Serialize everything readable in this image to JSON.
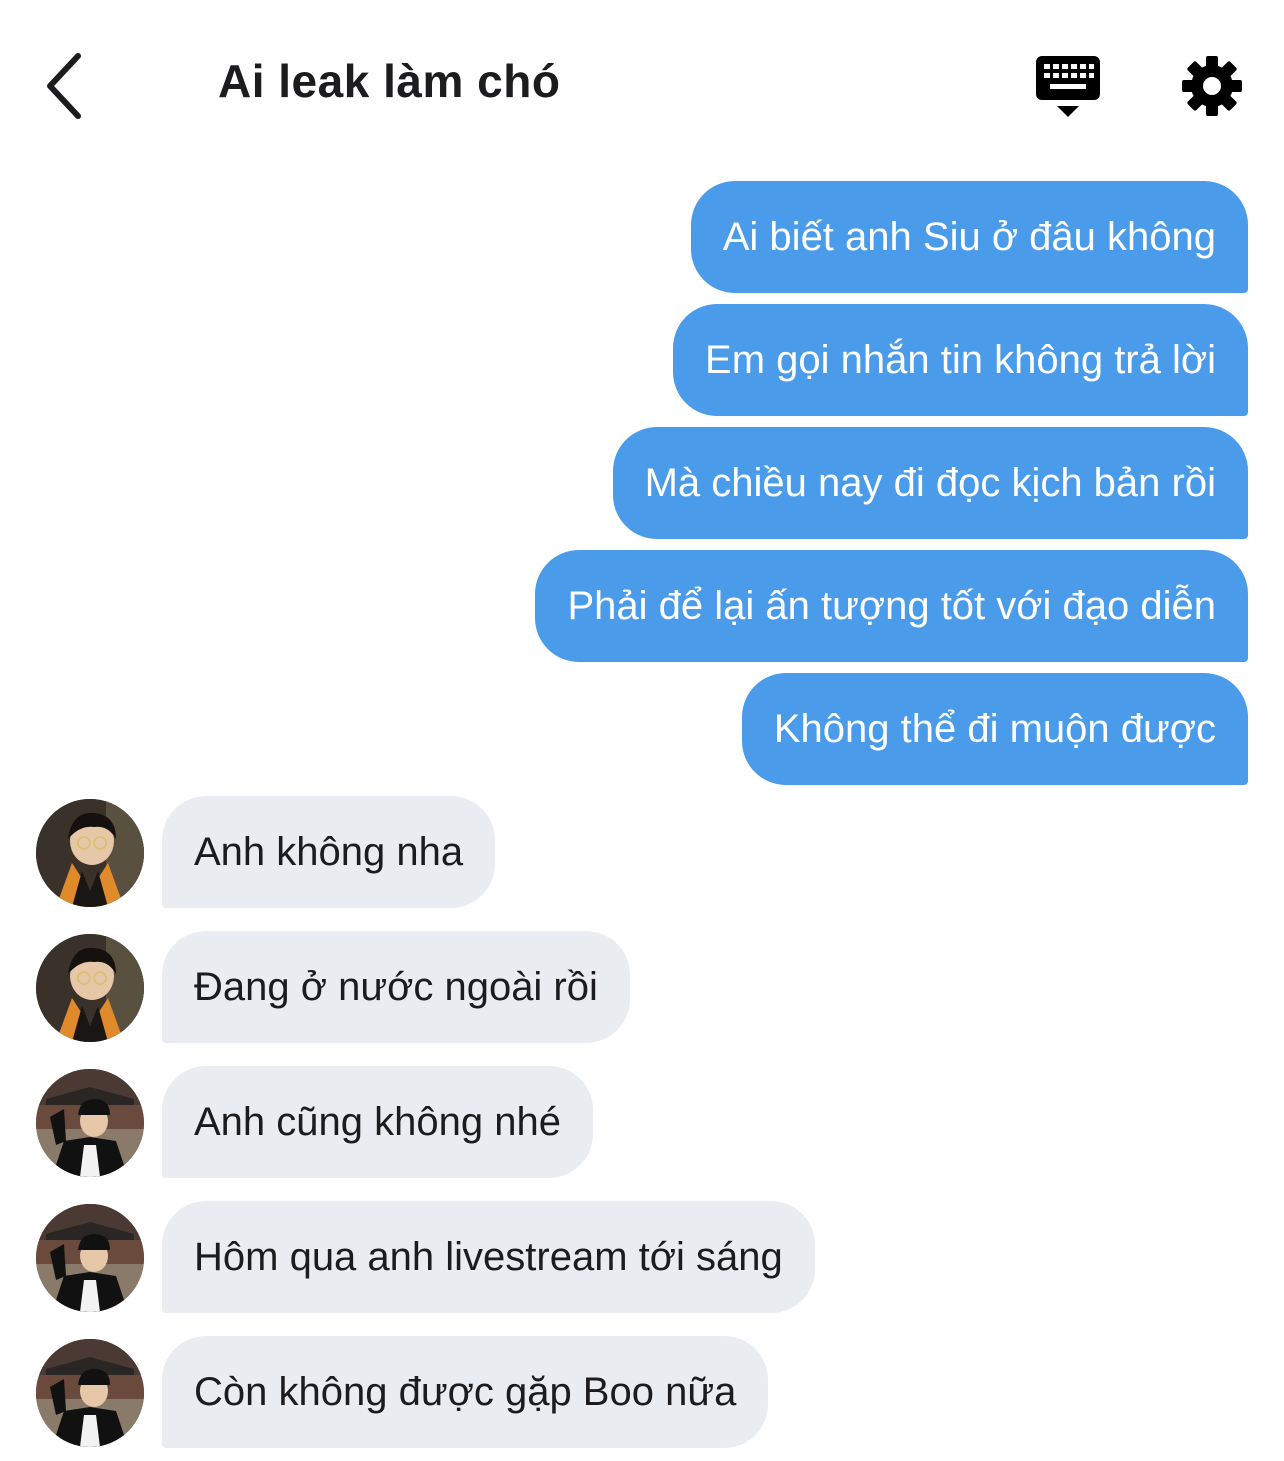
{
  "header": {
    "title": "Ai leak làm chó"
  },
  "colors": {
    "outgoing_bubble": "#4a9bea",
    "incoming_bubble": "#e9ecf0",
    "text_dark": "#1c1c1e"
  },
  "icons": {
    "back": "chevron-left-icon",
    "keyboard": "keyboard-icon",
    "settings": "gear-icon"
  },
  "messages": {
    "outgoing": [
      "Ai biết anh Siu ở đâu không",
      "Em gọi nhắn tin không trả lời",
      "Mà chiều nay đi đọc kịch bản rồi",
      "Phải để lại ấn tượng tốt với đạo diễn",
      "Không thể đi muộn được"
    ],
    "incoming": [
      "Anh không nha",
      "Đang ở nước ngoài rồi",
      "Anh cũng không nhé",
      "Hôm qua anh livestream tới sáng",
      "Còn không được gặp Boo nữa"
    ]
  }
}
